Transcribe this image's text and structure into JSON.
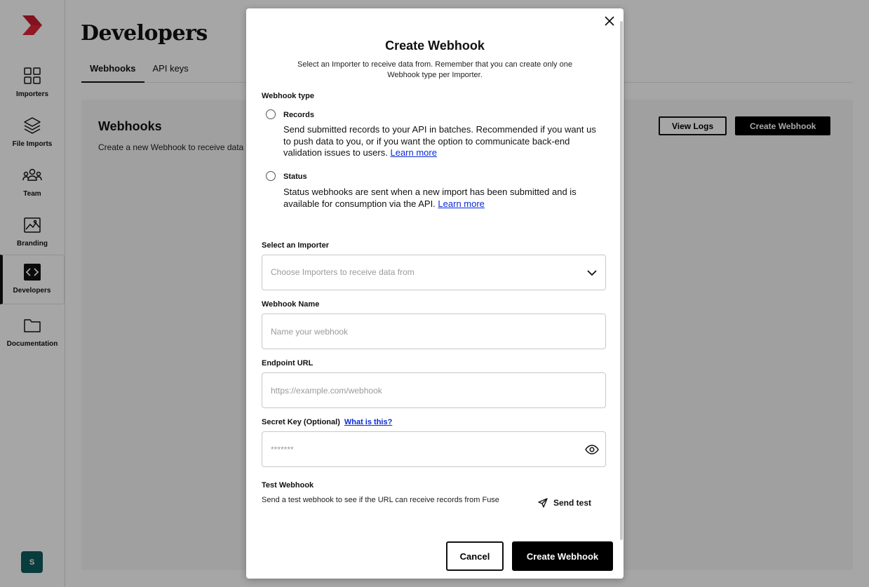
{
  "sidebar": {
    "items": [
      {
        "label": "Importers",
        "icon": "grid-icon"
      },
      {
        "label": "File Imports",
        "icon": "layers-icon"
      },
      {
        "label": "Team",
        "icon": "team-icon"
      },
      {
        "label": "Branding",
        "icon": "image-icon"
      },
      {
        "label": "Developers",
        "icon": "code-icon",
        "active": true
      },
      {
        "label": "Documentation",
        "icon": "folder-icon"
      }
    ],
    "avatar_initial": "S"
  },
  "page": {
    "title": "Developers",
    "tabs": [
      {
        "label": "Webhooks",
        "active": true
      },
      {
        "label": "API keys",
        "active": false
      }
    ],
    "panel": {
      "title": "Webhooks",
      "subtitle": "Create a new Webhook to receive data",
      "view_logs": "View Logs",
      "create_webhook": "Create Webhook"
    }
  },
  "modal": {
    "title": "Create Webhook",
    "subtitle": "Select an Importer to receive data from. Remember that you can create only one Webhook type per Importer.",
    "webhook_type_label": "Webhook type",
    "options": [
      {
        "title": "Records",
        "desc": "Send submitted records to your API in batches. Recommended if you want us to push data to you, or if you want the option to communicate back-end validation issues to users.",
        "link": "Learn more"
      },
      {
        "title": "Status",
        "desc": "Status webhooks are sent when a new import has been submitted and is available for consumption via the API.",
        "link": "Learn more"
      }
    ],
    "importer": {
      "label": "Select an Importer",
      "placeholder": "Choose Importers to receive data from"
    },
    "name": {
      "label": "Webhook Name",
      "placeholder": "Name your webhook"
    },
    "endpoint": {
      "label": "Endpoint URL",
      "placeholder": "https://example.com/webhook"
    },
    "secret": {
      "label": "Secret Key (Optional)",
      "help_link": "What is this?",
      "placeholder": "*******"
    },
    "test": {
      "label": "Test Webhook",
      "desc": "Send a test webhook to see if the URL can receive records from Fuse",
      "button": "Send test"
    },
    "cancel": "Cancel",
    "create": "Create Webhook"
  },
  "colors": {
    "brand": "#e0263a",
    "link": "#0a2bd6",
    "avatar": "#0f5c5c"
  }
}
